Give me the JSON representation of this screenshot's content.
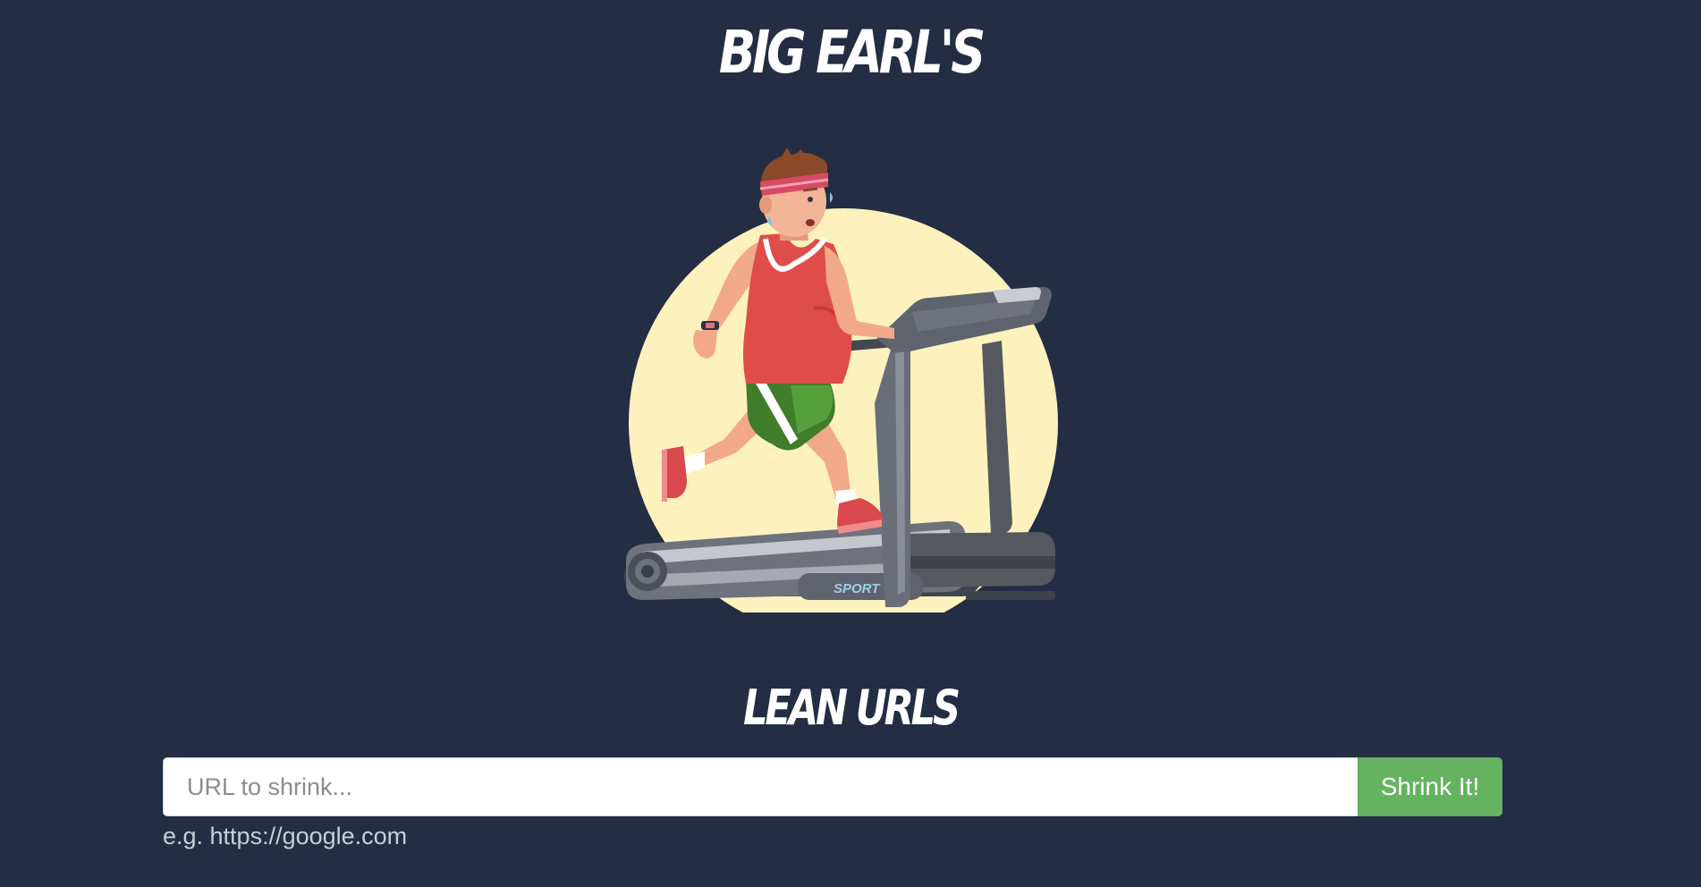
{
  "header": {
    "title": "BIG EARL'S"
  },
  "hero": {
    "illustration": "man-running-on-treadmill",
    "treadmill_brand": "SPORT"
  },
  "main": {
    "subtitle": "LEAN URLS"
  },
  "form": {
    "url_placeholder": "URL to shrink...",
    "url_value": "",
    "submit_label": "Shrink It!",
    "hint": "e.g. https://google.com"
  },
  "colors": {
    "background": "#232d43",
    "accent_button": "#65b360",
    "sun": "#fdf2bd",
    "text": "#ffffff"
  }
}
